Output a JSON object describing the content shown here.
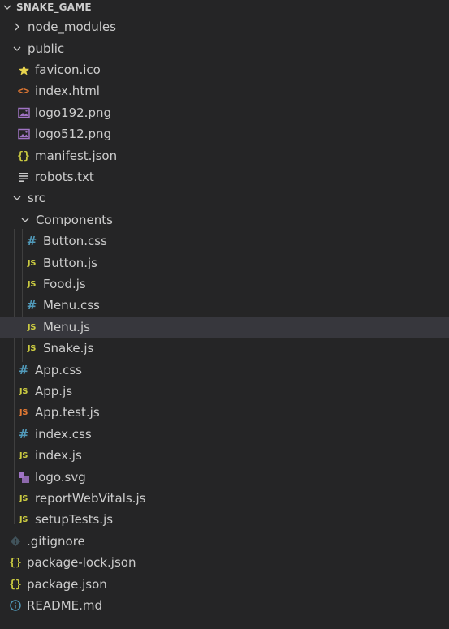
{
  "explorer": {
    "root": "SNAKE_GAME",
    "items": [
      {
        "label": "node_modules",
        "icon": "chevron-right-icon"
      },
      {
        "label": "public",
        "icon": "chevron-down-icon"
      },
      {
        "label": "favicon.ico",
        "icon": "star-icon"
      },
      {
        "label": "index.html",
        "icon": "html-icon"
      },
      {
        "label": "logo192.png",
        "icon": "image-icon"
      },
      {
        "label": "logo512.png",
        "icon": "image-icon"
      },
      {
        "label": "manifest.json",
        "icon": "json-icon"
      },
      {
        "label": "robots.txt",
        "icon": "text-file-icon"
      },
      {
        "label": "src",
        "icon": "chevron-down-icon"
      },
      {
        "label": "Components",
        "icon": "chevron-down-icon"
      },
      {
        "label": "Button.css",
        "icon": "css-icon"
      },
      {
        "label": "Button.js",
        "icon": "js-icon"
      },
      {
        "label": "Food.js",
        "icon": "js-icon"
      },
      {
        "label": "Menu.css",
        "icon": "css-icon"
      },
      {
        "label": "Menu.js",
        "icon": "js-icon",
        "selected": true
      },
      {
        "label": "Snake.js",
        "icon": "js-icon"
      },
      {
        "label": "App.css",
        "icon": "css-icon"
      },
      {
        "label": "App.js",
        "icon": "js-icon"
      },
      {
        "label": "App.test.js",
        "icon": "js-test-icon"
      },
      {
        "label": "index.css",
        "icon": "css-icon"
      },
      {
        "label": "index.js",
        "icon": "js-icon"
      },
      {
        "label": "logo.svg",
        "icon": "svg-icon"
      },
      {
        "label": "reportWebVitals.js",
        "icon": "js-icon"
      },
      {
        "label": "setupTests.js",
        "icon": "js-icon"
      },
      {
        "label": ".gitignore",
        "icon": "git-icon"
      },
      {
        "label": "package-lock.json",
        "icon": "json-icon"
      },
      {
        "label": "package.json",
        "icon": "json-icon"
      },
      {
        "label": "README.md",
        "icon": "info-icon"
      }
    ],
    "icon_glyphs": {
      "js": "JS",
      "css": "#",
      "json": "{}",
      "html": "<>"
    },
    "colors": {
      "background": "#252526",
      "selected_row": "#37373d",
      "text": "#cccccc",
      "js": "#cbcb41",
      "js_test": "#e37933",
      "css": "#519aba",
      "image": "#a074c4",
      "git": "#41535b",
      "info": "#519aba",
      "star": "#e8d44d"
    }
  }
}
